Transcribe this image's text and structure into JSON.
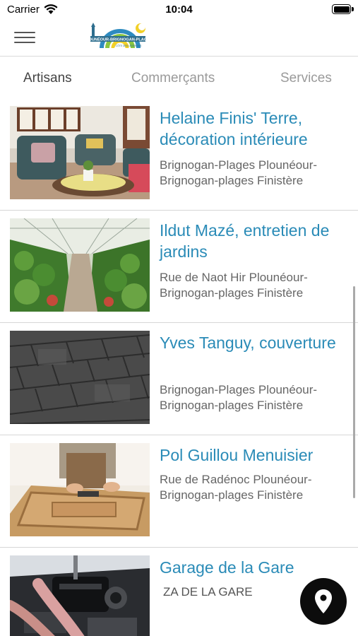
{
  "status_bar": {
    "carrier": "Carrier",
    "time": "10:04"
  },
  "header": {
    "menu_icon": "hamburger-icon",
    "logo_text": "PLOUNÉOUR-BRIGNOGAN-PLAGES",
    "logo_subtext": "CÔTE DES LÉGENDES",
    "logo_colors": [
      "#2e8bc0",
      "#8ac640",
      "#f2d028"
    ]
  },
  "tabs": [
    {
      "label": "Artisans",
      "active": true
    },
    {
      "label": "Commerçants",
      "active": false
    },
    {
      "label": "Services",
      "active": false
    }
  ],
  "items": [
    {
      "title": "Helaine Finis' Terre, décoration intérieure",
      "address": "Brignogan-Plages Plounéour-Brignogan-plages Finistère",
      "image": "living-room"
    },
    {
      "title": "Ildut Mazé, entretien de jardins",
      "address": "Rue de Naot Hir Plounéour-Brignogan-plages Finistère",
      "image": "greenhouse"
    },
    {
      "title": "Yves Tanguy, couverture",
      "address": "Brignogan-Plages Plounéour-Brignogan-plages Finistère",
      "image": "slate-roof"
    },
    {
      "title": "Pol Guillou Menuisier",
      "address": "Rue de Radénoc Plounéour-Brignogan-plages Finistère",
      "image": "carpentry"
    },
    {
      "title": "Garage de la Gare",
      "address": "ZA DE LA GARE",
      "image": "engine-bay"
    }
  ],
  "fab": {
    "icon": "map-pin-icon"
  },
  "colors": {
    "title_link": "#2a8bb7",
    "address": "#666666",
    "active_tab": "#444444",
    "inactive_tab": "#9a9a9a",
    "fab": "#0c0c0c"
  }
}
